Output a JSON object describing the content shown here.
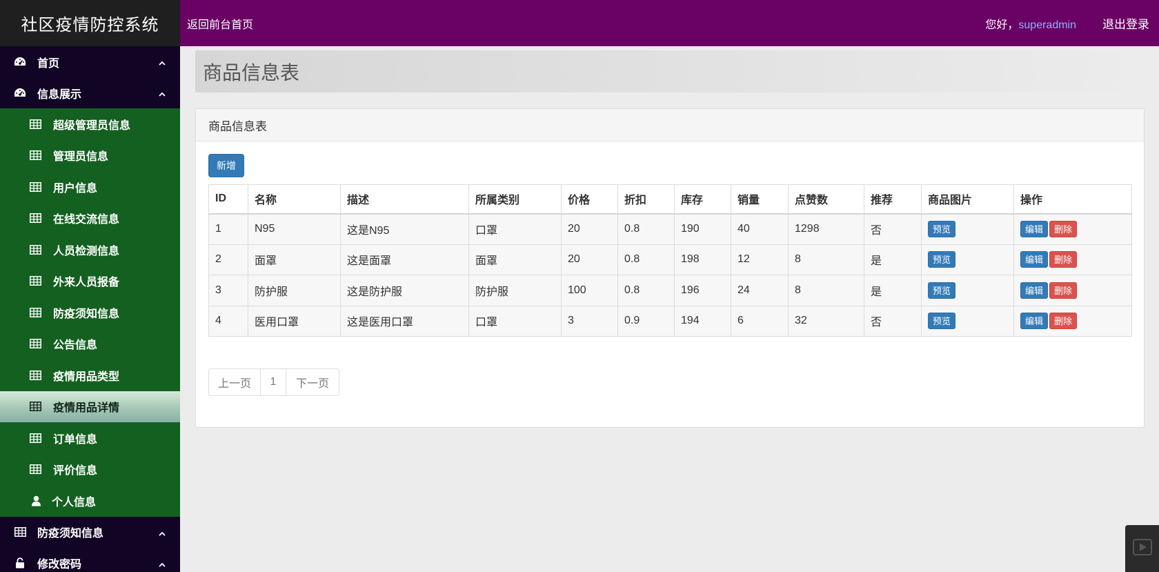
{
  "app": {
    "title": "社区疫情防控系统",
    "back_link": "返回前台首页",
    "greeting": "您好，",
    "username": "superadmin",
    "logout": "退出登录"
  },
  "sidebar": {
    "groups": [
      {
        "label": "首页",
        "icon": "dashboard-icon"
      },
      {
        "label": "信息展示",
        "icon": "dashboard-icon"
      }
    ],
    "items": [
      {
        "label": "超级管理员信息",
        "icon": "table-icon"
      },
      {
        "label": "管理员信息",
        "icon": "table-icon"
      },
      {
        "label": "用户信息",
        "icon": "table-icon"
      },
      {
        "label": "在线交流信息",
        "icon": "table-icon"
      },
      {
        "label": "人员检测信息",
        "icon": "table-icon"
      },
      {
        "label": "外来人员报备",
        "icon": "table-icon"
      },
      {
        "label": "防疫须知信息",
        "icon": "table-icon"
      },
      {
        "label": "公告信息",
        "icon": "table-icon"
      },
      {
        "label": "疫情用品类型",
        "icon": "table-icon"
      },
      {
        "label": "疫情用品详情",
        "icon": "table-icon",
        "active": true
      },
      {
        "label": "订单信息",
        "icon": "table-icon"
      },
      {
        "label": "评价信息",
        "icon": "table-icon"
      },
      {
        "label": "个人信息",
        "icon": "user-icon"
      }
    ],
    "bottom_groups": [
      {
        "label": "防疫须知信息",
        "icon": "table-icon"
      },
      {
        "label": "修改密码",
        "icon": "lock-icon"
      }
    ]
  },
  "main": {
    "page_title": "商品信息表",
    "panel_title": "商品信息表",
    "add_button": "新增",
    "table": {
      "headers": [
        "ID",
        "名称",
        "描述",
        "所属类别",
        "价格",
        "折扣",
        "库存",
        "销量",
        "点赞数",
        "推荐",
        "商品图片",
        "操作"
      ],
      "rows": [
        [
          "1",
          "N95",
          "这是N95",
          "口罩",
          "20",
          "0.8",
          "190",
          "40",
          "1298",
          "否"
        ],
        [
          "2",
          "面罩",
          "这是面罩",
          "面罩",
          "20",
          "0.8",
          "198",
          "12",
          "8",
          "是"
        ],
        [
          "3",
          "防护服",
          "这是防护服",
          "防护服",
          "100",
          "0.8",
          "196",
          "24",
          "8",
          "是"
        ],
        [
          "4",
          "医用口罩",
          "这是医用口罩",
          "口罩",
          "3",
          "0.9",
          "194",
          "6",
          "32",
          "否"
        ]
      ],
      "preview_label": "预览",
      "edit_label": "编辑",
      "delete_label": "删除"
    },
    "pagination": {
      "prev": "上一页",
      "current": "1",
      "next": "下一页"
    }
  },
  "colors": {
    "topbar": "#6a0164",
    "brand_bg": "#1f1f1f",
    "sidebar_bg": "#120425",
    "submenu_bg": "#136020",
    "primary": "#337ab7",
    "danger": "#d9534f"
  }
}
